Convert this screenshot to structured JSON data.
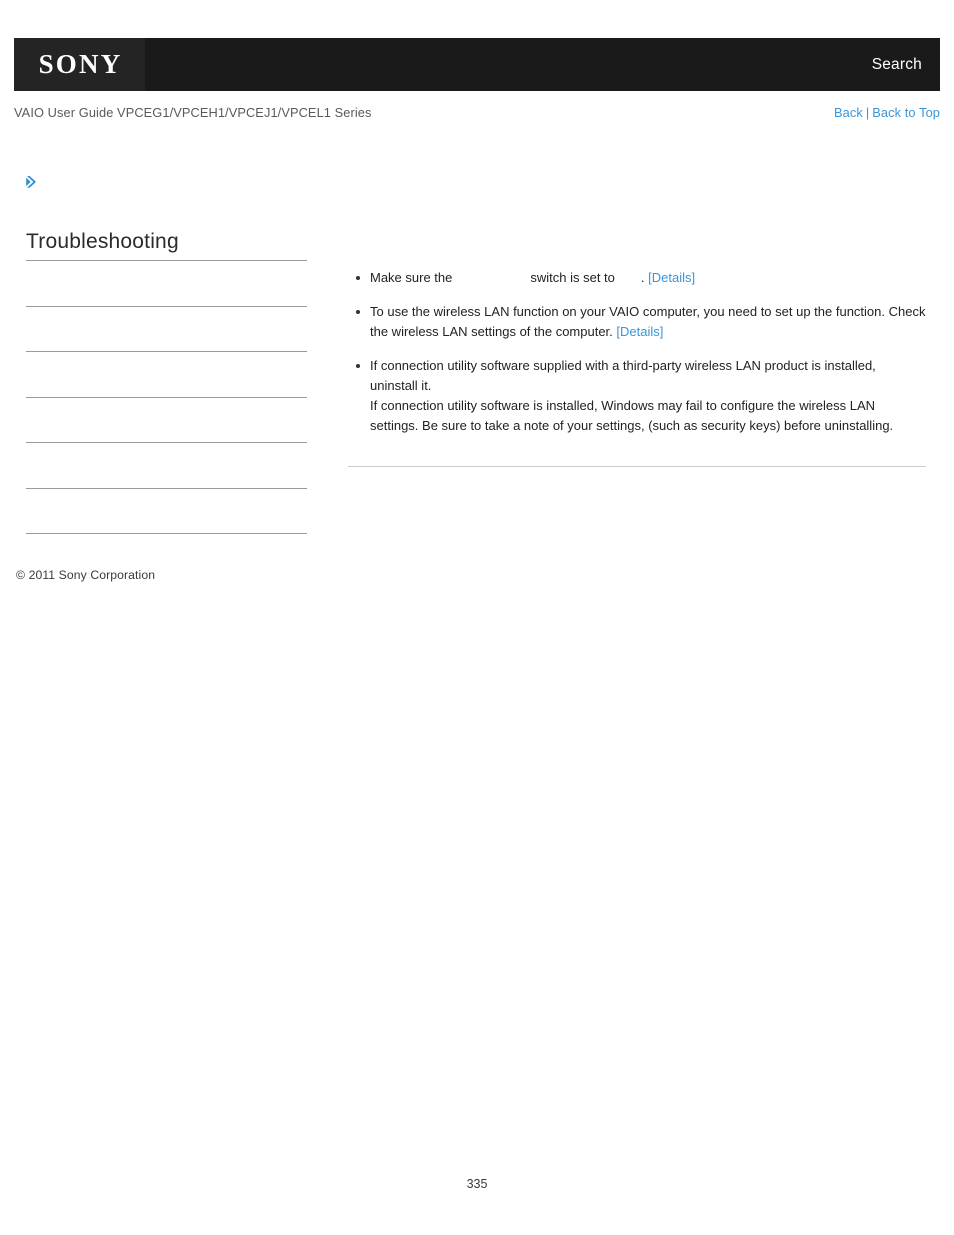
{
  "header": {
    "logo_text": "SONY",
    "search_label": "Search",
    "logo_bg": "#242424",
    "bar_bg": "#1a1a1a"
  },
  "subheader": {
    "guide_title": "VAIO User Guide VPCEG1/VPCEH1/VPCEJ1/VPCEL1 Series",
    "back_label": "Back",
    "separator": "|",
    "back_to_top_label": "Back to Top",
    "link_color": "#3b95d8"
  },
  "breadcrumb": {
    "arrow_icon": "double-chevron-right-icon",
    "arrow_color": "#2f8fd0",
    "label": ""
  },
  "sidebar": {
    "heading": "Troubleshooting",
    "items": [
      {
        "label": ""
      },
      {
        "label": ""
      },
      {
        "label": ""
      },
      {
        "label": ""
      },
      {
        "label": ""
      },
      {
        "label": ""
      }
    ],
    "copyright": "© 2011 Sony Corporation"
  },
  "content": {
    "bullets": [
      {
        "id": "wireless-switch-bullet",
        "segments": [
          {
            "type": "text",
            "value": "Make sure the "
          },
          {
            "type": "blank",
            "width": "wide"
          },
          {
            "type": "text",
            "value": " switch is set to "
          },
          {
            "type": "blank",
            "width": "narrow"
          },
          {
            "type": "text",
            "value": ". "
          },
          {
            "type": "link",
            "value": "[Details]"
          }
        ],
        "text_before_blank": "Make sure the",
        "text_middle": "switch is set to",
        "text_after": ".",
        "link_label": "[Details]"
      },
      {
        "id": "setup-function-bullet",
        "text": "To use the wireless LAN function on your VAIO computer, you need to set up the function. Check the wireless LAN settings of the computer.",
        "link_label": "[Details]"
      },
      {
        "id": "uninstall-utility-bullet",
        "text": "If connection utility software supplied with a third-party wireless LAN product is installed, uninstall it.\nIf connection utility software is installed, Windows may fail to configure the wireless LAN settings. Be sure to take a note of your settings, (such as security keys) before uninstalling.",
        "link_label": ""
      }
    ]
  },
  "footer": {
    "page_number": "335"
  }
}
